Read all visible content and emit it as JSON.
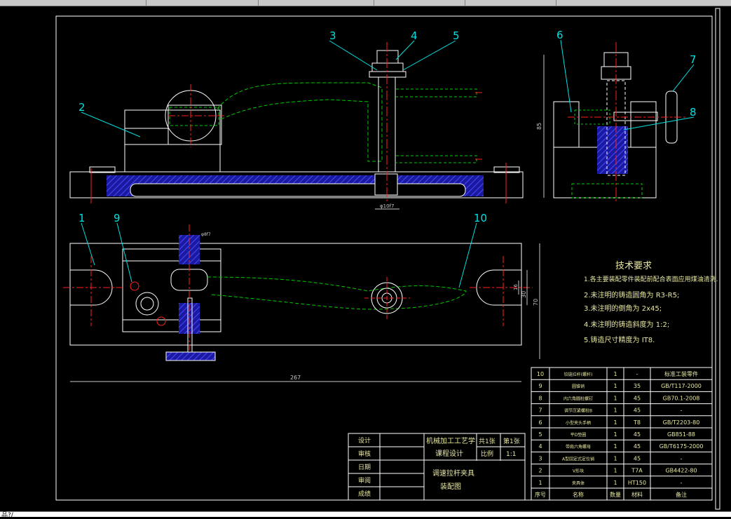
{
  "window": {
    "command_prompt": "品?/"
  },
  "colors": {
    "background": "#000000",
    "outline": "#ffffff",
    "hidden": "#00cc00",
    "center": "#ff2020",
    "hatch": "#3030ff",
    "dimension": "#c8c8c8",
    "leader": "#00e0e0",
    "text": "#e8e8a0"
  },
  "balloons": [
    {
      "id": "1",
      "label": "1"
    },
    {
      "id": "2",
      "label": "2"
    },
    {
      "id": "3",
      "label": "3"
    },
    {
      "id": "4",
      "label": "4"
    },
    {
      "id": "5",
      "label": "5"
    },
    {
      "id": "6",
      "label": "6"
    },
    {
      "id": "7",
      "label": "7"
    },
    {
      "id": "8",
      "label": "8"
    },
    {
      "id": "9",
      "label": "9"
    },
    {
      "id": "10",
      "label": "10"
    }
  ],
  "dimensions": {
    "phi_front": "φ10f7",
    "phi_top": "φ8f7",
    "height_85": "85",
    "length_267": "267",
    "width_70": "70",
    "dim_30": "30",
    "dim_16": "16"
  },
  "tech_requirements": {
    "title": "技术要求",
    "items": [
      "1.各主要装配零件装配前配合表面应用煤油清洗.",
      "2.未注明的铸造圆角为 R3-R5;",
      "3.未注明的倒角为 2x45;",
      "4.未注明的铸造斜度为 1:2;",
      "5.铸造尺寸精度为 IT8."
    ]
  },
  "bom": {
    "headers": [
      "序号",
      "名称",
      "数量",
      "材料",
      "备注"
    ],
    "rows": [
      [
        "10",
        "铰链拉杆(螺杆)",
        "1",
        "-",
        "标准工装零件"
      ],
      [
        "9",
        "圆锥销",
        "1",
        "35",
        "GB/T117-2000"
      ],
      [
        "8",
        "内六角圆柱螺钉",
        "1",
        "45",
        "GB70.1-2008"
      ],
      [
        "7",
        "调节压紧螺柱B",
        "1",
        "45",
        "-"
      ],
      [
        "6",
        "小型夹头手柄",
        "1",
        "T8",
        "GB/T2203-80"
      ],
      [
        "5",
        "平D垫圈",
        "1",
        "45",
        "GB851-88"
      ],
      [
        "4",
        "带肩六角螺母",
        "1",
        "45",
        "GB/T6175-2000"
      ],
      [
        "3",
        "A型固定式定位销",
        "1",
        "45",
        "-"
      ],
      [
        "2",
        "V形块",
        "1",
        "T7A",
        "GB4422-80"
      ],
      [
        "1",
        "夹具体",
        "1",
        "HT150",
        "-"
      ]
    ]
  },
  "title_block": {
    "left_labels": [
      "设计",
      "审核",
      "日期",
      "审阅",
      "成绩"
    ],
    "course_l1": "机械加工工艺学",
    "course_l2": "课程设计",
    "sheet_total": "共1张",
    "sheet_no": "第1张",
    "scale_label": "比例",
    "scale_value": "1:1",
    "drawing_l1": "调速拉杆夹具",
    "drawing_l2": "装配图"
  }
}
